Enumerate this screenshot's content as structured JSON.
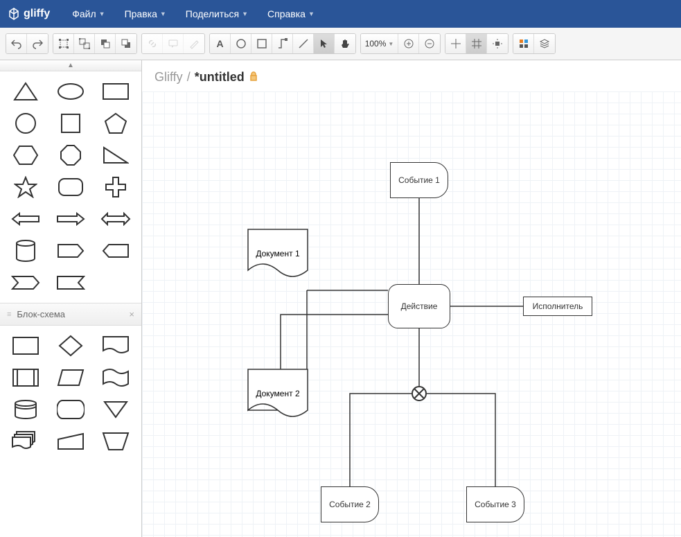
{
  "app": {
    "name": "gliffy"
  },
  "menu": {
    "file": "Файл",
    "edit": "Правка",
    "share": "Поделиться",
    "help": "Справка"
  },
  "toolbar": {
    "zoom": "100%"
  },
  "breadcrumb": {
    "root": "Gliffy",
    "sep": "/",
    "doc": "*untitled"
  },
  "sidebar": {
    "section_flowchart": "Блок-схема"
  },
  "diagram": {
    "event1": "Событие 1",
    "doc1": "Документ 1",
    "doc2": "Документ 2",
    "action": "Действие",
    "executor": "Исполнитель",
    "event2": "Событие 2",
    "event3": "Событие 3"
  }
}
